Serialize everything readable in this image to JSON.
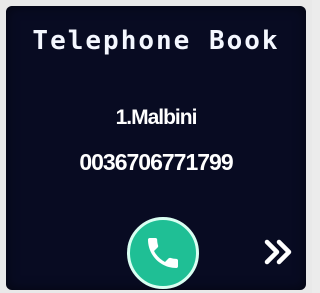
{
  "header": {
    "title": "Telephone Book"
  },
  "contact": {
    "name": "1.Malbini",
    "number": "0036706771799"
  },
  "actions": {
    "call_icon": "phone-icon",
    "next_icon": "double-chevron-right-icon"
  },
  "colors": {
    "screen_background": "#080b22",
    "text": "#ffffff",
    "call_button": "#1fbf95"
  }
}
